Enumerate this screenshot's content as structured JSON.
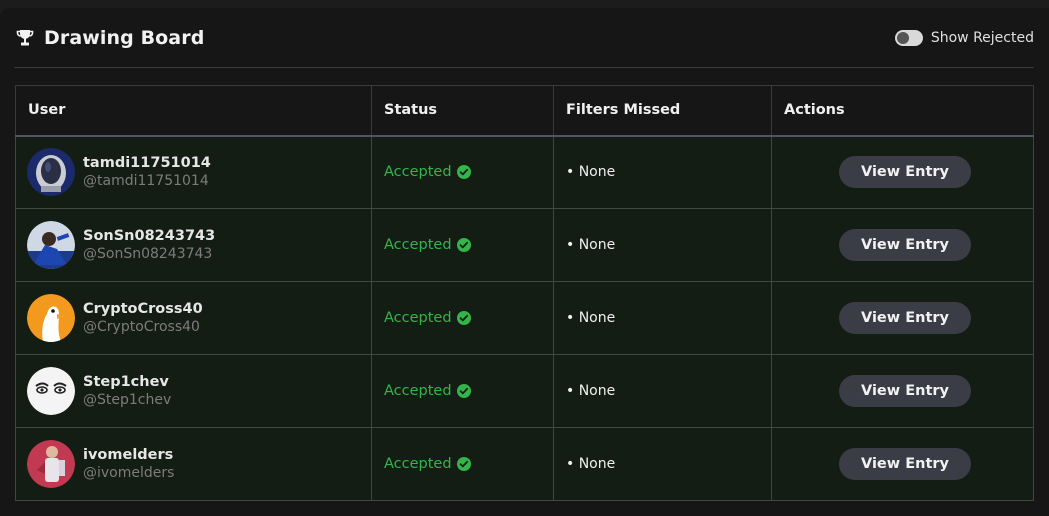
{
  "header": {
    "title": "Drawing Board",
    "title_icon": "trophy-icon",
    "toggle_label": "Show Rejected",
    "toggle_on": false
  },
  "table": {
    "columns": [
      "User",
      "Status",
      "Filters Missed",
      "Actions"
    ],
    "rows": [
      {
        "name": "tamdi11751014",
        "handle": "@tamdi11751014",
        "status": "Accepted",
        "filters": "• None",
        "action": "View Entry",
        "avatar": "astronaut-helmet-avatar"
      },
      {
        "name": "SonSn08243743",
        "handle": "@SonSn08243743",
        "status": "Accepted",
        "filters": "• None",
        "action": "View Entry",
        "avatar": "footballer-avatar"
      },
      {
        "name": "CryptoCross40",
        "handle": "@CryptoCross40",
        "status": "Accepted",
        "filters": "• None",
        "action": "View Entry",
        "avatar": "goose-avatar"
      },
      {
        "name": "Step1chev",
        "handle": "@Step1chev",
        "status": "Accepted",
        "filters": "• None",
        "action": "View Entry",
        "avatar": "cartoon-face-avatar"
      },
      {
        "name": "ivomelders",
        "handle": "@ivomelders",
        "status": "Accepted",
        "filters": "• None",
        "action": "View Entry",
        "avatar": "figure-avatar"
      }
    ]
  },
  "colors": {
    "accepted": "#33b54a",
    "button_bg": "#3a3d46",
    "row_bg": "#141d14"
  }
}
